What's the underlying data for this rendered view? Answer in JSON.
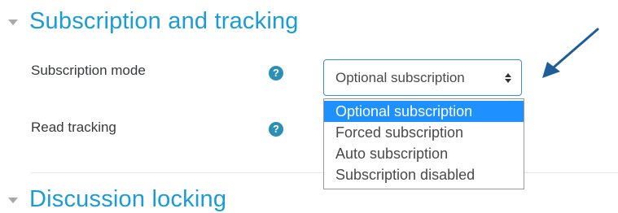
{
  "sections": [
    {
      "title": "Subscription and tracking"
    },
    {
      "title": "Discussion locking"
    }
  ],
  "fields": {
    "subscription_mode": {
      "label": "Subscription mode",
      "help_icon": "?",
      "selected_value": "Optional subscription",
      "options": [
        "Optional subscription",
        "Forced subscription",
        "Auto subscription",
        "Subscription disabled"
      ]
    },
    "read_tracking": {
      "label": "Read tracking",
      "help_icon": "?"
    }
  },
  "colors": {
    "section_title": "#1a9cd6",
    "help_icon": "#2b8fb6",
    "selected_option_bg": "#1e90ff",
    "select_border": "#3c8fd0",
    "annotation_arrow": "#1f5d99"
  },
  "icons": {
    "section_toggle": "caret-down-icon",
    "help": "question-circle-icon",
    "select_arrows": "updown-arrows-icon",
    "annotation": "arrow-annotation-icon"
  }
}
